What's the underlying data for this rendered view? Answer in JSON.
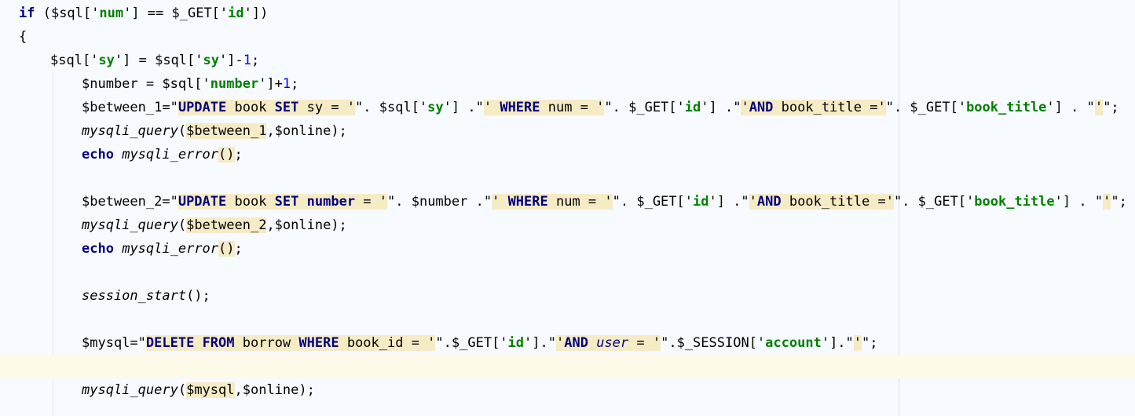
{
  "lines": [
    {
      "tokens": [
        {
          "t": "if",
          "c": "kw"
        },
        {
          "t": " ($sql['"
        },
        {
          "t": "num",
          "c": "str"
        },
        {
          "t": "'] == $_GET['"
        },
        {
          "t": "id",
          "c": "str"
        },
        {
          "t": "'])"
        }
      ]
    },
    {
      "tokens": [
        {
          "t": "{"
        }
      ]
    },
    {
      "tokens": [
        {
          "t": "$sql['"
        },
        {
          "t": "sy",
          "c": "str"
        },
        {
          "t": "'] = $sql['"
        },
        {
          "t": "sy",
          "c": "str"
        },
        {
          "t": "']-"
        },
        {
          "t": "1",
          "c": "num"
        },
        {
          "t": ";"
        }
      ]
    },
    {
      "tokens": [
        {
          "t": "$number = $sql['"
        },
        {
          "t": "number",
          "c": "str"
        },
        {
          "t": "']+"
        },
        {
          "t": "1",
          "c": "num"
        },
        {
          "t": ";"
        }
      ]
    },
    {
      "tokens": [
        {
          "t": "$between_1=\""
        },
        {
          "t": "UPDATE",
          "c": "sqlb"
        },
        {
          "t": " book ",
          "c": "sql"
        },
        {
          "t": "SET",
          "c": "sqlb"
        },
        {
          "t": " sy = '",
          "c": "sql"
        },
        {
          "t": "\". $sql['"
        },
        {
          "t": "sy",
          "c": "str"
        },
        {
          "t": "'] .\""
        },
        {
          "t": "' ",
          "c": "sql"
        },
        {
          "t": "WHERE",
          "c": "sqlb"
        },
        {
          "t": " num = '",
          "c": "sql"
        },
        {
          "t": "\". $_GET['"
        },
        {
          "t": "id",
          "c": "str"
        },
        {
          "t": "'] .\""
        },
        {
          "t": "'",
          "c": "sql"
        },
        {
          "t": "AND",
          "c": "sqlb"
        },
        {
          "t": " book_title ='",
          "c": "sql"
        },
        {
          "t": "\". $_GET['"
        },
        {
          "t": "book_title",
          "c": "str"
        },
        {
          "t": "'] . \""
        },
        {
          "t": "'",
          "c": "sql"
        },
        {
          "t": "\";"
        }
      ]
    },
    {
      "tokens": [
        {
          "t": "mysqli_query",
          "c": "fn"
        },
        {
          "t": "("
        },
        {
          "t": "$between_1",
          "c": "mhl"
        },
        {
          "t": ",$online);"
        }
      ]
    },
    {
      "tokens": [
        {
          "t": "echo",
          "c": "kw"
        },
        {
          "t": " "
        },
        {
          "t": "mysqli_error",
          "c": "fn"
        },
        {
          "t": "()",
          "c": "mhl"
        },
        {
          "t": ";"
        }
      ]
    },
    {
      "tokens": []
    },
    {
      "tokens": [
        {
          "t": "$between_2=\""
        },
        {
          "t": "UPDATE",
          "c": "sqlb"
        },
        {
          "t": " book ",
          "c": "sql"
        },
        {
          "t": "SET",
          "c": "sqlb"
        },
        {
          "t": " ",
          "c": "sql"
        },
        {
          "t": "number",
          "c": "sqlb"
        },
        {
          "t": " = '",
          "c": "sql"
        },
        {
          "t": "\". $number .\""
        },
        {
          "t": "' ",
          "c": "sql"
        },
        {
          "t": "WHERE",
          "c": "sqlb"
        },
        {
          "t": " num = '",
          "c": "sql"
        },
        {
          "t": "\". $_GET['"
        },
        {
          "t": "id",
          "c": "str"
        },
        {
          "t": "'] .\""
        },
        {
          "t": "'",
          "c": "sql"
        },
        {
          "t": "AND",
          "c": "sqlb"
        },
        {
          "t": " book_title ='",
          "c": "sql"
        },
        {
          "t": "\". $_GET['"
        },
        {
          "t": "book_title",
          "c": "str"
        },
        {
          "t": "'] . \""
        },
        {
          "t": "'",
          "c": "sql"
        },
        {
          "t": "\";"
        }
      ]
    },
    {
      "tokens": [
        {
          "t": "mysqli_query",
          "c": "fn"
        },
        {
          "t": "("
        },
        {
          "t": "$between_2",
          "c": "mhl"
        },
        {
          "t": ",$online);"
        }
      ]
    },
    {
      "tokens": [
        {
          "t": "echo",
          "c": "kw"
        },
        {
          "t": " "
        },
        {
          "t": "mysqli_error",
          "c": "fn"
        },
        {
          "t": "()",
          "c": "mhl"
        },
        {
          "t": ";"
        }
      ]
    },
    {
      "tokens": []
    },
    {
      "tokens": [
        {
          "t": "session_start",
          "c": "fn"
        },
        {
          "t": "();"
        }
      ]
    },
    {
      "tokens": []
    },
    {
      "tokens": [
        {
          "t": "$mysql=\""
        },
        {
          "t": "DELETE",
          "c": "sqlb"
        },
        {
          "t": " ",
          "c": "sql"
        },
        {
          "t": "FROM",
          "c": "sqlb"
        },
        {
          "t": " borrow ",
          "c": "sql"
        },
        {
          "t": "WHERE",
          "c": "sqlb"
        },
        {
          "t": " book_id = '",
          "c": "sql"
        },
        {
          "t": "\".$_GET['"
        },
        {
          "t": "id",
          "c": "str"
        },
        {
          "t": "'].\""
        },
        {
          "t": "'",
          "c": "sql"
        },
        {
          "t": "AND",
          "c": "sqlb"
        },
        {
          "t": " ",
          "c": "sql"
        },
        {
          "t": "user",
          "c": "sqli"
        },
        {
          "t": " = '",
          "c": "sql"
        },
        {
          "t": "\".$_SESSION['"
        },
        {
          "t": "account",
          "c": "str"
        },
        {
          "t": "'].\""
        },
        {
          "t": "'",
          "c": "sql"
        },
        {
          "t": "\";"
        }
      ]
    },
    {
      "tokens": []
    },
    {
      "tokens": [
        {
          "t": "mysqli_query",
          "c": "fn"
        },
        {
          "t": "("
        },
        {
          "t": "$mysql",
          "c": "mhl"
        },
        {
          "t": ",$online);"
        }
      ]
    }
  ]
}
